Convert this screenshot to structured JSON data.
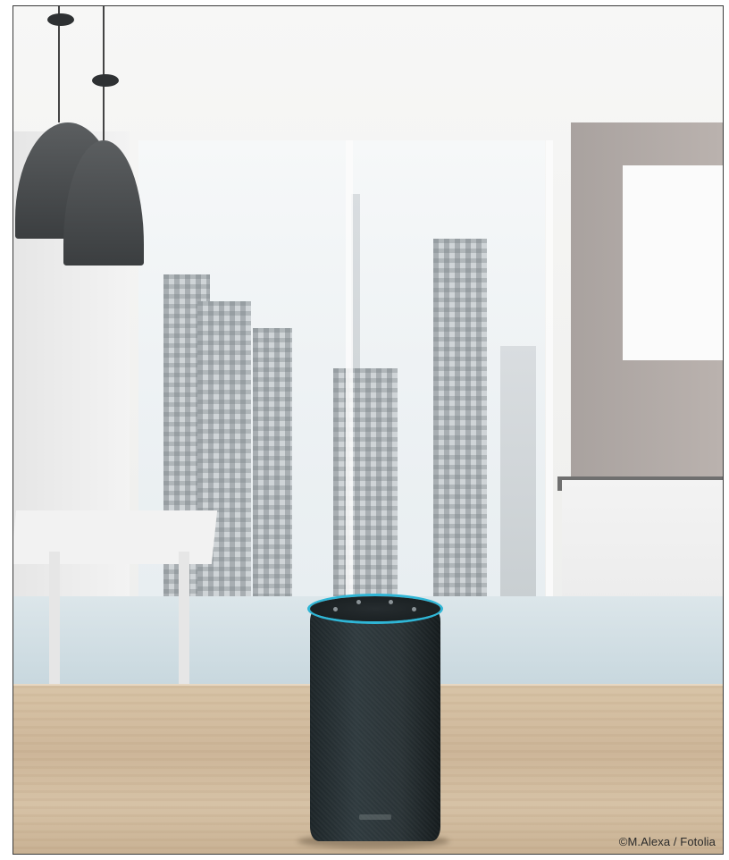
{
  "photo": {
    "subject": "smart-speaker",
    "accent_colors": {
      "light_ring": "#2fb6d6",
      "speaker_fabric": "#2a3336",
      "wood": "#d3bea1"
    }
  },
  "credit": {
    "copyright_symbol": "©",
    "text": "M.Alexa / Fotolia"
  }
}
